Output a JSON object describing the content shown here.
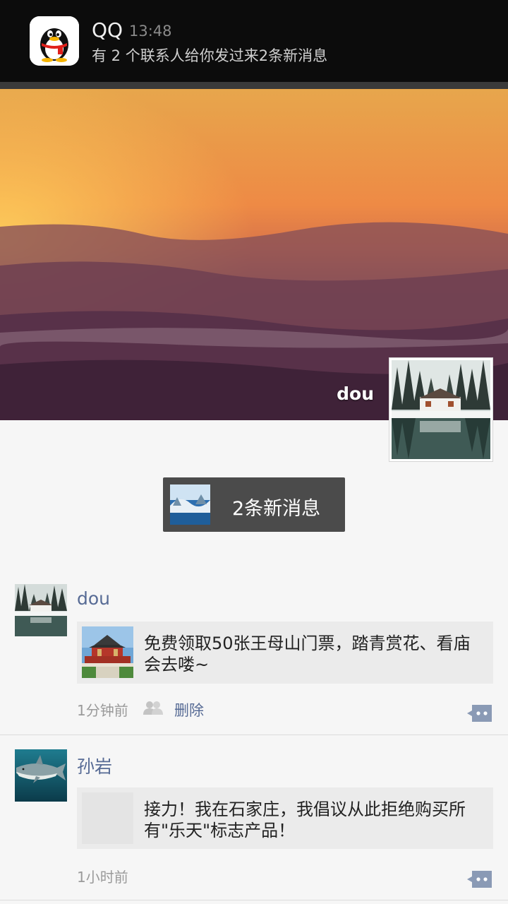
{
  "notification": {
    "app": "QQ",
    "time": "13:48",
    "text": "有 2 个联系人给你发过来2条新消息",
    "icon": "qq-penguin-icon"
  },
  "cover": {
    "user_name": "dou"
  },
  "new_messages": {
    "label": "2条新消息"
  },
  "posts": [
    {
      "name": "dou",
      "content": "免费领取50张王母山门票，踏青赏花、看庙会去喽~",
      "time": "1分钟前",
      "visibility_icon": "friends-icon",
      "delete_label": "删除",
      "comment_icon": "comment-icon"
    },
    {
      "name": "孙岩",
      "content": "接力！我在石家庄，我倡议从此拒绝购买所有\"乐天\"标志产品！",
      "time": "1小时前",
      "comment_icon": "comment-icon"
    }
  ],
  "colors": {
    "link": "#576b95",
    "notification_bg": "#0c0c0c",
    "card_bg": "#ebebeb"
  }
}
